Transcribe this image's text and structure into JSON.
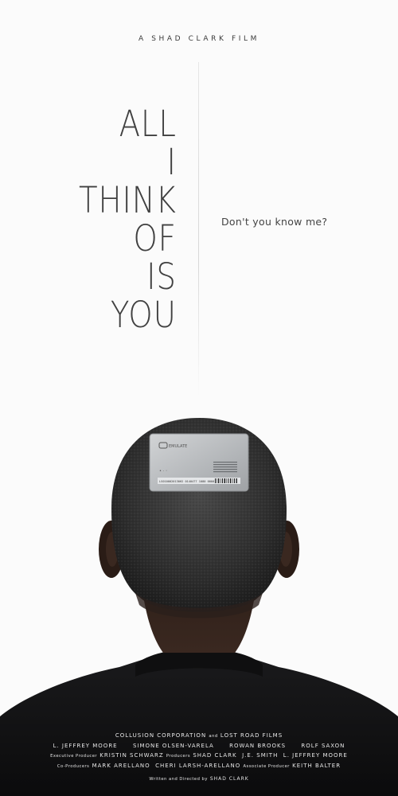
{
  "header": {
    "presenter": "A SHAD CLARK FILM"
  },
  "title": {
    "lines": [
      "ALL",
      "I",
      "THINK",
      "OF",
      "IS",
      "YOU"
    ]
  },
  "tagline": "Don't you know me?",
  "card": {
    "brand": "EMULATE",
    "serial": "LS0100020130H2 0140477 1080 0000"
  },
  "credits": {
    "companies": "COLLUSION CORPORATION",
    "and_word": "and",
    "companies_2": "LOST ROAD FILMS",
    "cast": [
      "L. JEFFREY MOORE",
      "SIMONE OLSEN-VARELA",
      "ROWAN BROOKS",
      "ROLF SAXON"
    ],
    "exec_label": "Executive Producer",
    "exec_name": "KRISTIN SCHWARZ",
    "producers_label": "Producers",
    "producers": [
      "SHAD CLARK",
      "J.E. SMITH",
      "L. JEFFREY MOORE"
    ],
    "coproducers_label": "Co-Producers",
    "coproducers": [
      "MARK ARELLANO",
      "CHERI LARSH-ARELLANO"
    ],
    "associate_label": "Associate Producer",
    "associate_name": "KEITH BALTER",
    "written_label": "Written and Directed by",
    "written_name": "SHAD CLARK"
  }
}
